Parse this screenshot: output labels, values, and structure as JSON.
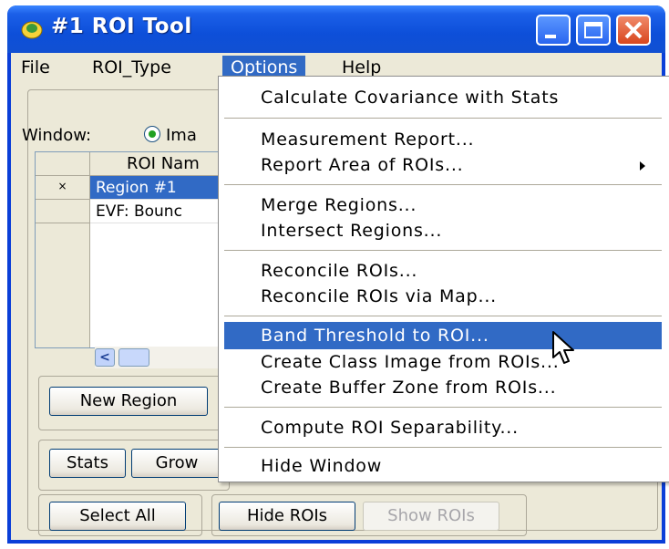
{
  "window": {
    "title": "#1 ROI Tool"
  },
  "menubar": {
    "file": "File",
    "roi_type": "ROI_Type",
    "options": "Options",
    "help": "Help"
  },
  "panel": {
    "window_label": "Window:",
    "radio_label": "Ima",
    "table": {
      "header": "ROI Nam",
      "rows": [
        {
          "marker": "×",
          "name": "Region #1"
        },
        {
          "marker": "",
          "name": "EVF: Bounc"
        }
      ]
    },
    "buttons": {
      "new_region": "New Region",
      "stats": "Stats",
      "grow": "Grow",
      "select_all": "Select All",
      "hide_rois": "Hide ROIs",
      "show_rois": "Show ROIs"
    }
  },
  "options_menu": {
    "items": [
      "Calculate Covariance with Stats",
      "Measurement Report...",
      "Report Area of ROIs...",
      "Merge Regions...",
      "Intersect Regions...",
      "Reconcile ROIs...",
      "Reconcile ROIs via Map...",
      "Band Threshold to ROI...",
      "Create Class Image from ROIs...",
      "Create Buffer Zone from ROIs...",
      "Compute ROI Separability...",
      "Hide Window"
    ],
    "highlighted_index": 7
  },
  "colors": {
    "titlebar": "#0d4fd9",
    "selection": "#316ac5",
    "face": "#ece9d8"
  }
}
